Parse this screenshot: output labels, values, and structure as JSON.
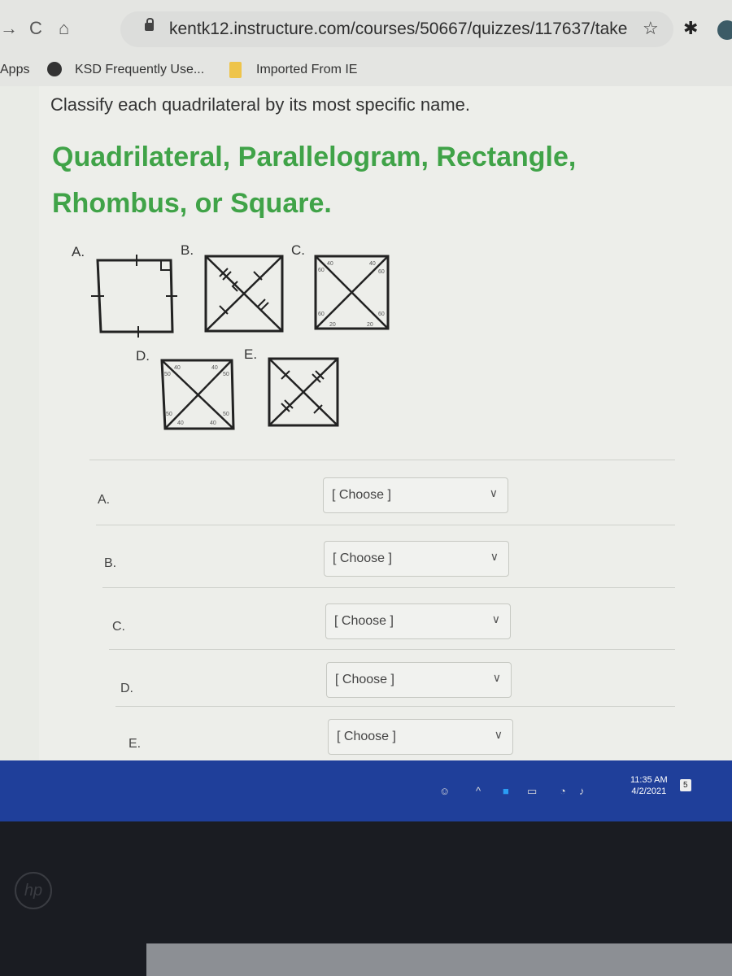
{
  "browser": {
    "url": "kentk12.instructure.com/courses/50667/quizzes/117637/take",
    "nav": {
      "forward": "→",
      "reload": "C",
      "home": "⌂"
    },
    "bookmarks": [
      {
        "label": "Apps"
      },
      {
        "label": "KSD Frequently Use..."
      },
      {
        "label": "Imported From IE"
      }
    ]
  },
  "question": {
    "instruction": "Classify each quadrilateral by its most specific name.",
    "options_heading": "Quadrilateral, Parallelogram, Rectangle, Rhombus, or Square.",
    "figures": [
      {
        "label": "A.",
        "type": "square with equal-side ticks and right angle"
      },
      {
        "label": "B.",
        "type": "quadrilateral with perpendicular bisecting diagonals"
      },
      {
        "label": "C.",
        "type": "quadrilateral with angle measures",
        "angles": [
          "40",
          "60",
          "40",
          "60",
          "60",
          "20",
          "60",
          "20"
        ]
      },
      {
        "label": "D.",
        "type": "quadrilateral with angle measures",
        "angles": [
          "40",
          "50",
          "40",
          "50",
          "50",
          "40",
          "50",
          "40"
        ]
      },
      {
        "label": "E.",
        "type": "quadrilateral with bisected diagonals"
      }
    ],
    "answers": [
      {
        "label": "A.",
        "value": "[ Choose ]"
      },
      {
        "label": "B.",
        "value": "[ Choose ]"
      },
      {
        "label": "C.",
        "value": "[ Choose ]"
      },
      {
        "label": "D.",
        "value": "[ Choose ]"
      },
      {
        "label": "E.",
        "value": "[ Choose ]"
      }
    ]
  },
  "taskbar": {
    "time": "11:35 AM",
    "date": "4/2/2021",
    "notification_count": "5"
  },
  "device": {
    "logo": "hp"
  }
}
